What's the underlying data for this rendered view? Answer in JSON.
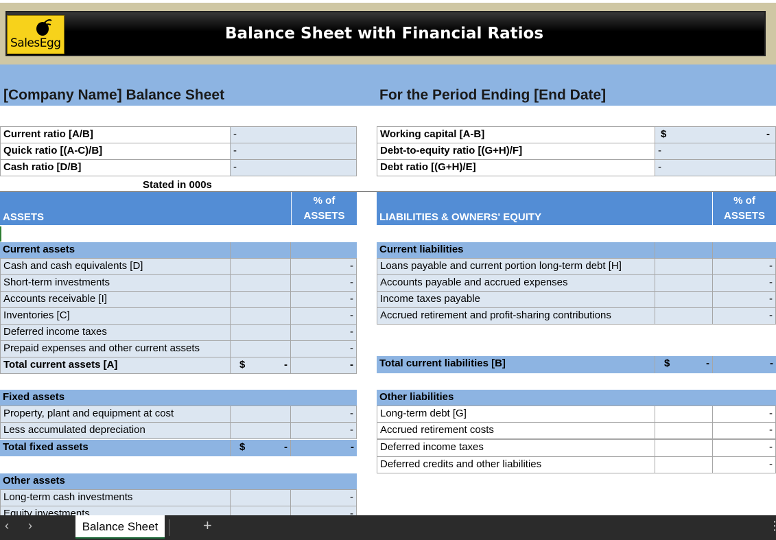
{
  "header": {
    "title": "Balance Sheet with Financial Ratios",
    "logo_text": "SalesEgg"
  },
  "company": {
    "left": "[Company Name] Balance Sheet",
    "right": "For the Period Ending [End Date]"
  },
  "ratios_left": [
    {
      "label": "Current ratio  [A/B]",
      "value": "-"
    },
    {
      "label": "Quick ratio  [(A-C)/B]",
      "value": "-"
    },
    {
      "label": "Cash ratio  [D/B]",
      "value": "-"
    }
  ],
  "ratios_right": [
    {
      "label": "Working capital  [A-B]",
      "value": "$",
      "value2": "-"
    },
    {
      "label": "Debt-to-equity ratio  [(G+H)/F]",
      "value": "-"
    },
    {
      "label": "Debt ratio  [(G+H)/E]",
      "value": "-"
    }
  ],
  "stated": "Stated in 000s",
  "assets": {
    "header": "ASSETS",
    "pct_line1": "% of",
    "pct_line2": "ASSETS",
    "current": {
      "title": "Current assets",
      "rows": [
        "Cash and cash equivalents  [D]",
        "Short-term investments",
        "Accounts receivable  [I]",
        "Inventories  [C]",
        "Deferred income taxes",
        "Prepaid expenses and other current assets"
      ],
      "total": "Total current assets  [A]"
    },
    "fixed": {
      "title": "Fixed assets",
      "rows": [
        "Property, plant and equipment at cost",
        "Less accumulated depreciation"
      ],
      "total": "Total fixed assets"
    },
    "other": {
      "title": "Other assets",
      "rows": [
        "Long-term cash investments",
        "Equity investments"
      ]
    }
  },
  "liabilities": {
    "header": "LIABILITIES & OWNERS' EQUITY",
    "pct_line1": "% of",
    "pct_line2": "ASSETS",
    "current": {
      "title": "Current liabilities",
      "rows": [
        "Loans payable and current portion long-term debt  [H]",
        "Accounts payable and accrued expenses",
        "Income taxes payable",
        "Accrued retirement and profit-sharing contributions"
      ],
      "total": "Total current liabilities  [B]"
    },
    "other": {
      "title": "Other liabilities",
      "rows": [
        "Long-term debt  [G]",
        "Accrued retirement costs",
        "Deferred income taxes",
        "Deferred credits and other liabilities"
      ]
    }
  },
  "symbols": {
    "dash": "-",
    "dollar": "$"
  },
  "tabs": {
    "sheet": "Balance Sheet",
    "add": "+",
    "prev": "‹",
    "next": "›",
    "menu": "⋮"
  }
}
